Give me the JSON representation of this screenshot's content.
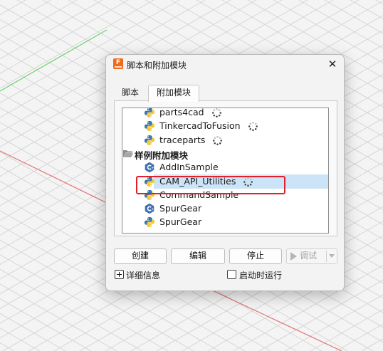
{
  "dialog": {
    "title": "脚本和附加模块",
    "icon_letter": "F",
    "close_glyph": "✕",
    "accent": "#f26b1d"
  },
  "tabs": [
    {
      "label": "脚本",
      "active": false
    },
    {
      "label": "附加模块",
      "active": true
    }
  ],
  "tree": {
    "items": [
      {
        "label": "parts4cad",
        "icon": "python-icon",
        "loading": true
      },
      {
        "label": "TinkercadToFusion",
        "icon": "python-icon",
        "loading": true
      },
      {
        "label": "traceparts",
        "icon": "python-icon",
        "loading": true
      },
      {
        "label": "样例附加模块",
        "icon": "folder-open-icon",
        "category": true
      },
      {
        "label": "AddInSample",
        "icon": "cpp-icon"
      },
      {
        "label": "CAM_API_Utilities",
        "icon": "python-icon",
        "loading": true,
        "selected": true
      },
      {
        "label": "CommandSample",
        "icon": "python-icon"
      },
      {
        "label": "SpurGear",
        "icon": "cpp-icon"
      },
      {
        "label": "SpurGear",
        "icon": "python-icon"
      }
    ],
    "highlight_color": "#e0202a",
    "selection_color": "#cce4f7"
  },
  "buttons": {
    "create": "创建",
    "edit": "编辑",
    "stop": "停止",
    "debug": "调试"
  },
  "footer": {
    "details_label": "详细信息",
    "run_on_startup_label": "启动时运行",
    "run_on_startup_checked": false
  }
}
